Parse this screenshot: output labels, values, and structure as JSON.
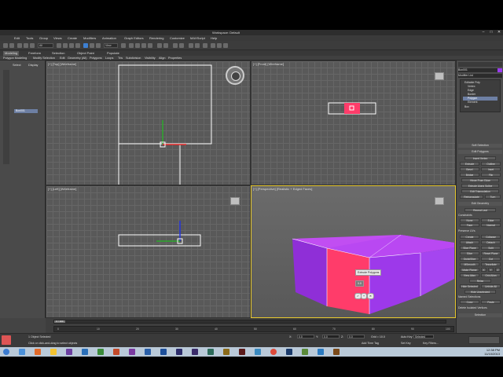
{
  "app": {
    "title": "Workspace: Default",
    "window_controls": [
      "–",
      "□",
      "✕"
    ]
  },
  "menu": [
    "Edit",
    "Tools",
    "Group",
    "Views",
    "Create",
    "Modifiers",
    "Animation",
    "Graph Editors",
    "Rendering",
    "Customize",
    "MAXScript",
    "Help"
  ],
  "toolbar": {
    "selection_filter": "All",
    "view_dropdown": "View"
  },
  "ribbon": {
    "tabs": [
      "Modeling",
      "Freeform",
      "Selection",
      "Object Paint",
      "Populate"
    ],
    "active_tab": "Modeling",
    "row": [
      "Polygon Modeling",
      "Modify Selection",
      "Edit",
      "Geometry (All)",
      "Polygons",
      "Loops",
      "Tris",
      "Subdivision",
      "Visibility",
      "Align",
      "Properties"
    ]
  },
  "scene_explorer": {
    "tabs": [
      "Select",
      "Display"
    ],
    "item": "Box001"
  },
  "viewports": {
    "top": "[+] [Top] [Wireframe]",
    "front": "[+] [Front] [Wireframe]",
    "left": "[+] [Left] [Wireframe]",
    "perspective": "[+] [Perspective] [Realistic + Edged Faces]"
  },
  "perspective_caddy": {
    "title": "Extrude Polygons",
    "value": "0.0",
    "ok_symbols": [
      "✓",
      "+",
      "✕"
    ]
  },
  "command_panel": {
    "object_name": "Box001",
    "modifier_list": "Modifier List",
    "stack": [
      "Editable Poly",
      "Vertex",
      "Edge",
      "Border",
      "Polygon",
      "Element",
      "Box"
    ],
    "selected_stack_item": "Polygon",
    "sections": {
      "soft_selection": "Soft Selection",
      "edit_polygons": "Edit Polygons",
      "edit_geometry": "Edit Geometry",
      "selection": "Selection"
    },
    "buttons": [
      "Insert Vertex",
      "Extrude",
      "Outline",
      "Bevel",
      "Inset",
      "Bridge",
      "Flip",
      "Hinge From Edge",
      "Extrude Along Spline",
      "Edit Triangulation",
      "Retriangulate",
      "Turn",
      "Repeat Last",
      "Constraints",
      "None",
      "Edge",
      "Face",
      "Normal",
      "Preserve UVs",
      "Create",
      "Collapse",
      "Attach",
      "Detach",
      "Slice Plane",
      "Split",
      "Slice",
      "Reset Plane",
      "QuickSlice",
      "Cut",
      "MSmooth",
      "Tessellate",
      "Make Planar",
      "X",
      "Y",
      "Z",
      "View Align",
      "Grid Align",
      "Relax",
      "Hide Selected",
      "Unhide All",
      "Hide Unselected",
      "Named Selections",
      "Copy",
      "Paste",
      "Delete Isolated Vertices"
    ]
  },
  "timeline": {
    "frame": "0 / 100",
    "ticks": [
      "0",
      "10",
      "20",
      "30",
      "40",
      "50",
      "60",
      "70",
      "80",
      "90",
      "100"
    ]
  },
  "status_bar": {
    "selection": "1 Object Selected",
    "hint": "Click or click-and-drag to select objects",
    "x_label": "X:",
    "x_value": "0.0",
    "y_label": "Y:",
    "y_value": "0.0",
    "z_label": "Z:",
    "z_value": "0.0",
    "grid": "Grid = 10.0",
    "auto_key": "Auto Key",
    "selected": "Selected",
    "set_key": "Set Key",
    "key_filters": "Key Filters...",
    "add_time_tag": "Add Time Tag"
  },
  "taskbar": {
    "time": "12:38 PM",
    "date": "11/10/2013"
  },
  "colors": {
    "selected_face": "#ff3c6a",
    "object": "#9b3cf0",
    "active_border": "#e7c82e",
    "accent": "#6d7fa3"
  }
}
